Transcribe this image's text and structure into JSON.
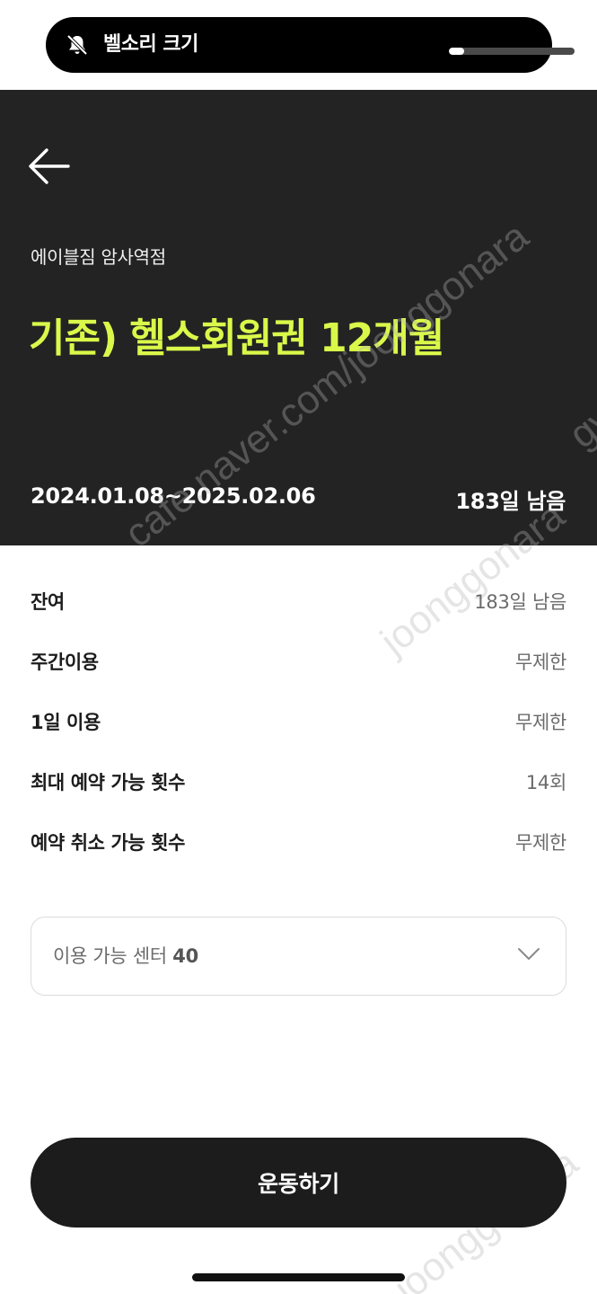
{
  "volume_hud": {
    "label": "벨소리 크기",
    "icon": "bell-muted-icon",
    "level": 0.12
  },
  "header": {
    "back_icon": "back-arrow-icon",
    "gym_name": "에이블짐 암사역점",
    "plan_title": "기존) 헬스회원권 12개월",
    "period": "2024.01.08~2025.02.06",
    "remaining": "183일 남음",
    "accent_color": "#d9f84a"
  },
  "info": {
    "rows": [
      {
        "label": "잔여",
        "value": "183일 남음"
      },
      {
        "label": "주간이용",
        "value": "무제한"
      },
      {
        "label": "1일 이용",
        "value": "무제한"
      },
      {
        "label": "최대 예약 가능 횟수",
        "value": "14회"
      },
      {
        "label": "예약 취소 가능 횟수",
        "value": "무제한"
      }
    ]
  },
  "center_dropdown": {
    "label": "이용 가능 센터",
    "count": "40",
    "icon": "chevron-down-icon"
  },
  "workout_button": {
    "label": "운동하기"
  },
  "watermarks": [
    "cafe.naver.com/joonggonara",
    "joonggonara",
    "gvi",
    "cafe.",
    "joonggonara"
  ]
}
